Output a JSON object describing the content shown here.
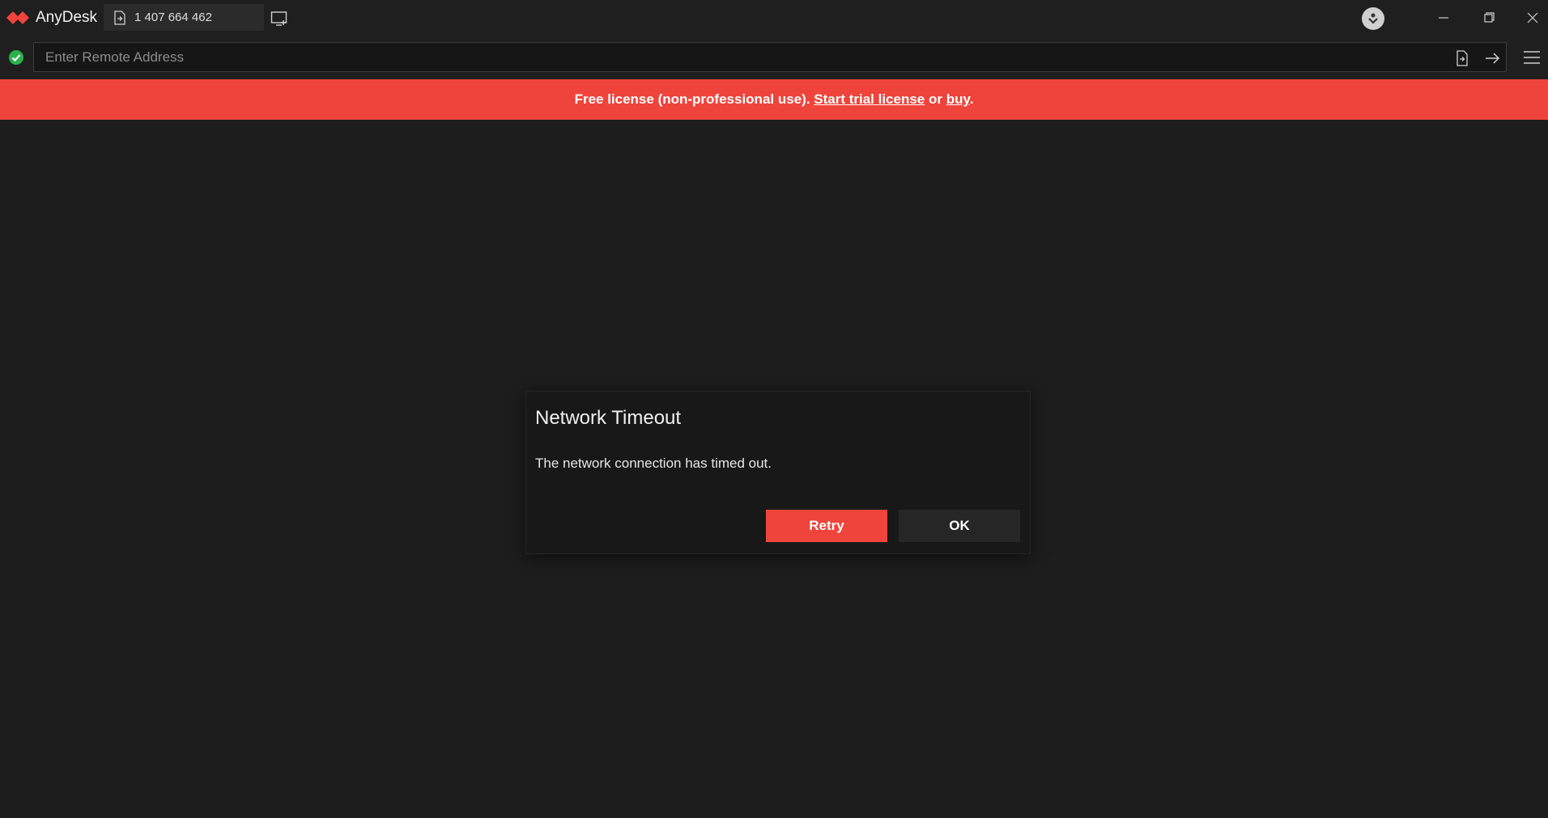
{
  "app": {
    "name": "AnyDesk",
    "brand_color": "#ef443b"
  },
  "tab": {
    "label": "1 407 664 462",
    "icon": "file-transfer-icon"
  },
  "window_controls": [
    "minimize-icon",
    "restore-icon",
    "close-icon"
  ],
  "addressbar": {
    "placeholder": "Enter Remote Address",
    "value": "",
    "status": "online",
    "status_color": "#2bb14a"
  },
  "banner": {
    "text_before": "Free license (non-professional use). ",
    "trial_link": "Start trial license",
    "text_middle": " or ",
    "buy_link": "buy",
    "text_after": ".",
    "color": "#ef443b"
  },
  "dialog": {
    "title": "Network Timeout",
    "message": "The network connection has timed out.",
    "retry_label": "Retry",
    "ok_label": "OK"
  }
}
